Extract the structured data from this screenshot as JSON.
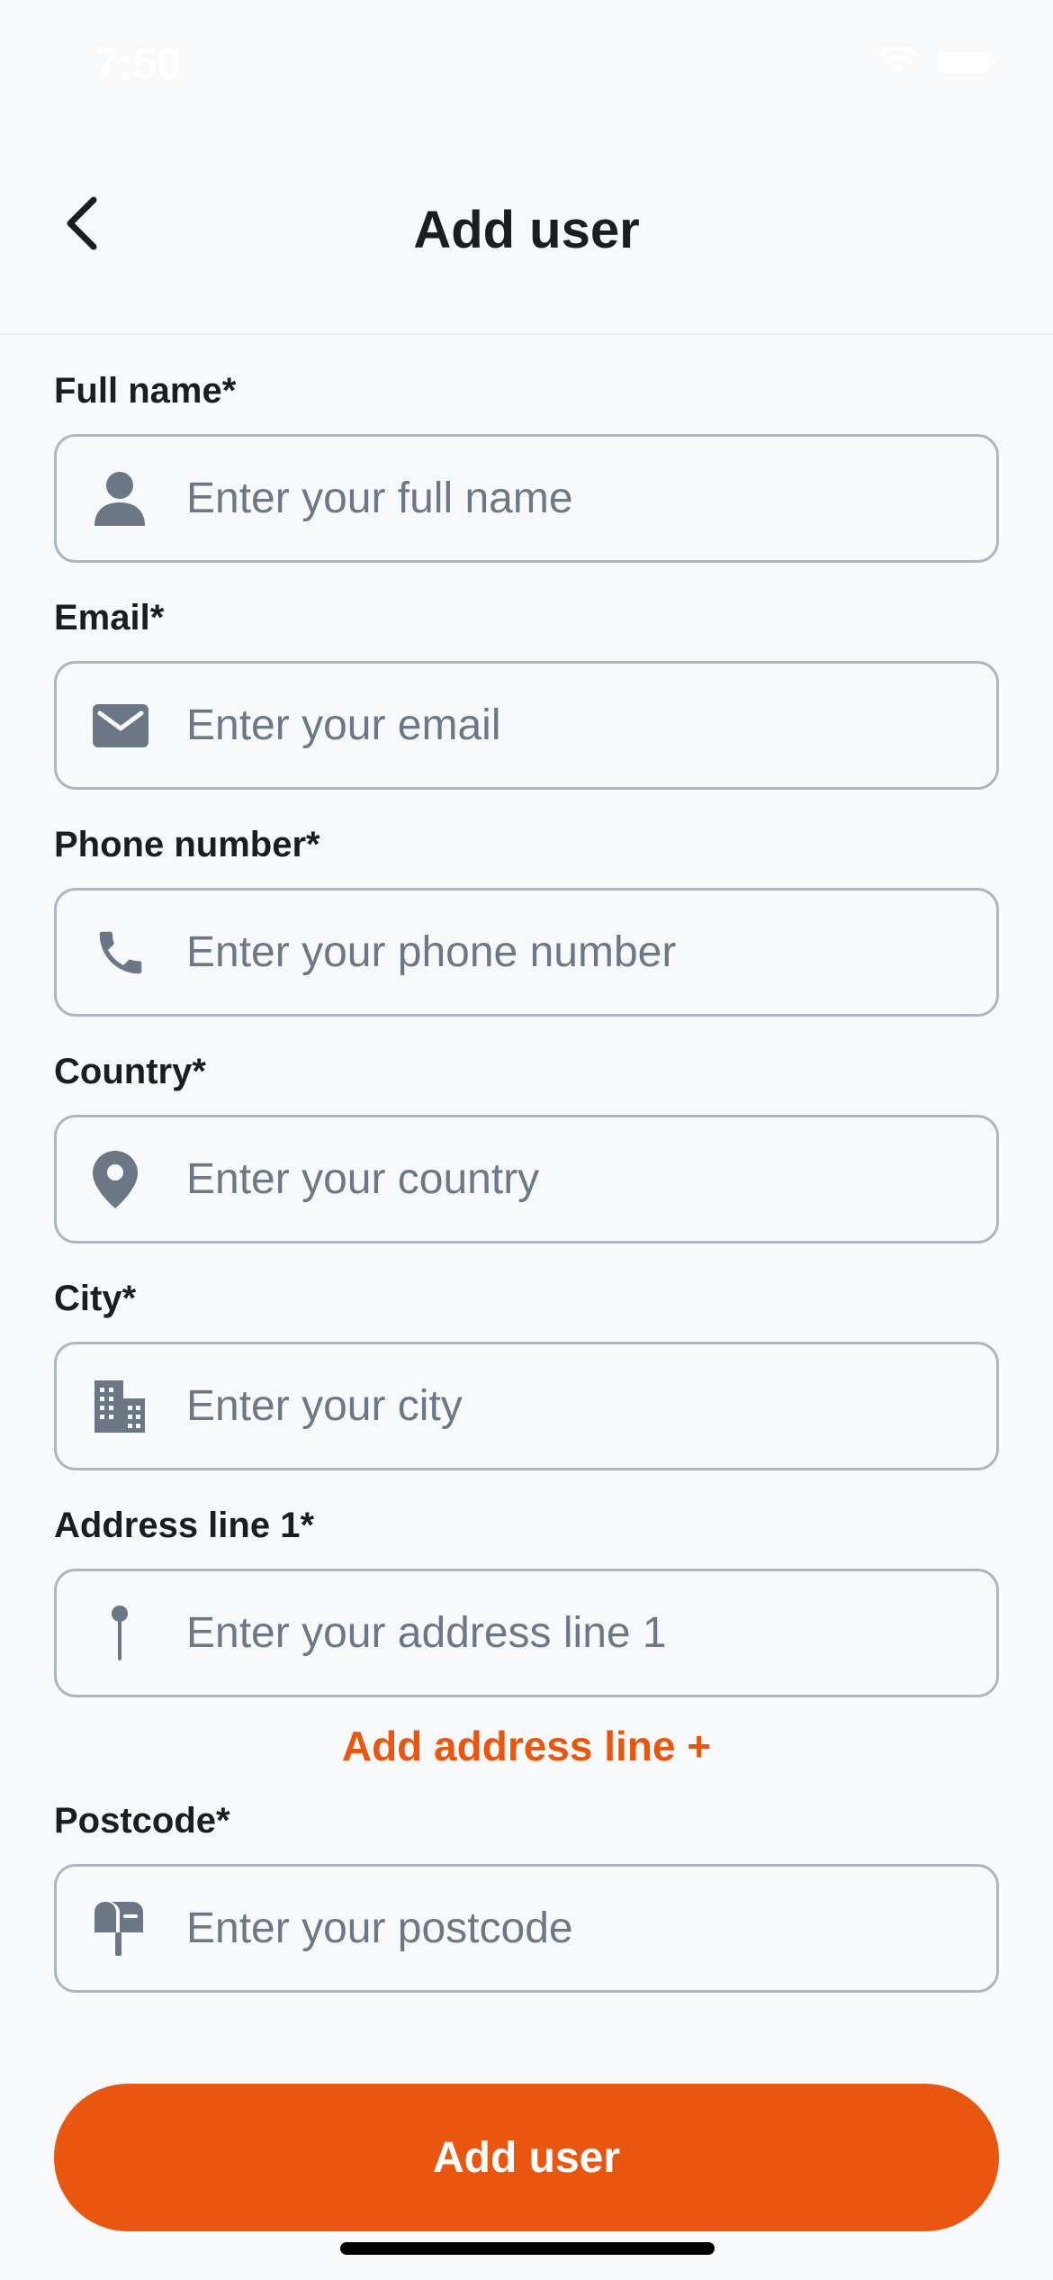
{
  "status_bar": {
    "time": "7:50"
  },
  "header": {
    "title": "Add user",
    "back_icon": "chevron-left-icon"
  },
  "fields": [
    {
      "label": "Full name*",
      "placeholder": "Enter your full name",
      "icon": "person-icon"
    },
    {
      "label": "Email*",
      "placeholder": "Enter your email",
      "icon": "envelope-icon"
    },
    {
      "label": "Phone number*",
      "placeholder": "Enter your phone number",
      "icon": "phone-icon"
    },
    {
      "label": "Country*",
      "placeholder": "Enter your country",
      "icon": "location-pin-icon"
    },
    {
      "label": "City*",
      "placeholder": "Enter your city",
      "icon": "building-icon"
    },
    {
      "label": "Address line 1*",
      "placeholder": "Enter your address line 1",
      "icon": "map-pin-icon"
    },
    {
      "label": "Postcode*",
      "placeholder": "Enter your postcode",
      "icon": "mailbox-icon"
    }
  ],
  "add_address_line": "Add address line +",
  "submit_button": "Add user",
  "colors": {
    "accent": "#e8560f",
    "icon": "#6b7785",
    "border": "#aeb6c1",
    "background": "#f8f9fb"
  }
}
